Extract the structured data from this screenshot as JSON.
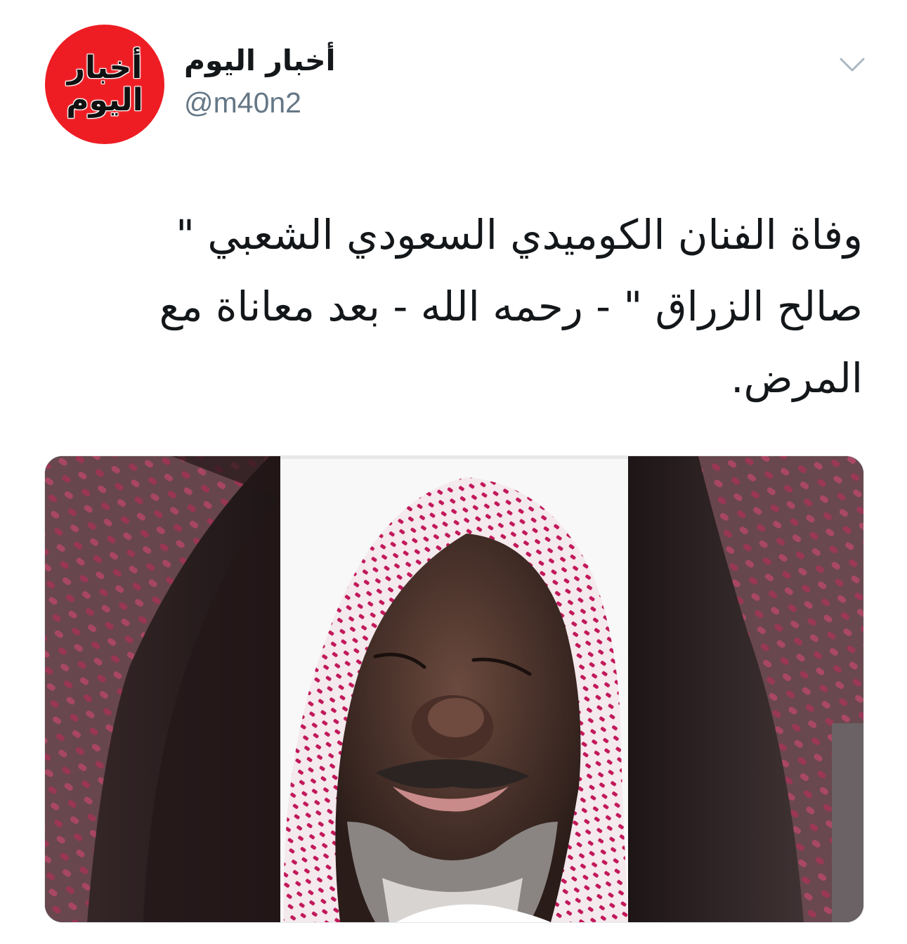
{
  "tweet": {
    "author": {
      "avatar_text_line1": "أخبار",
      "avatar_text_line2": "اليوم",
      "avatar_color": "#ee1d23",
      "display_name": "أخبار اليوم",
      "handle": "@m40n2"
    },
    "menu_icon": "chevron-down-icon",
    "text": "وفاة الفنان الكوميدي السعودي الشعبي \" صالح الزراق \" - رحمه الله - بعد معاناة مع المرض.",
    "media": {
      "type": "photo",
      "icon": "photo-portrait"
    }
  },
  "colors": {
    "text_primary": "#14171a",
    "text_secondary": "#657786",
    "chevron": "#aab8c2",
    "shemagh_red": "#c2185b"
  }
}
